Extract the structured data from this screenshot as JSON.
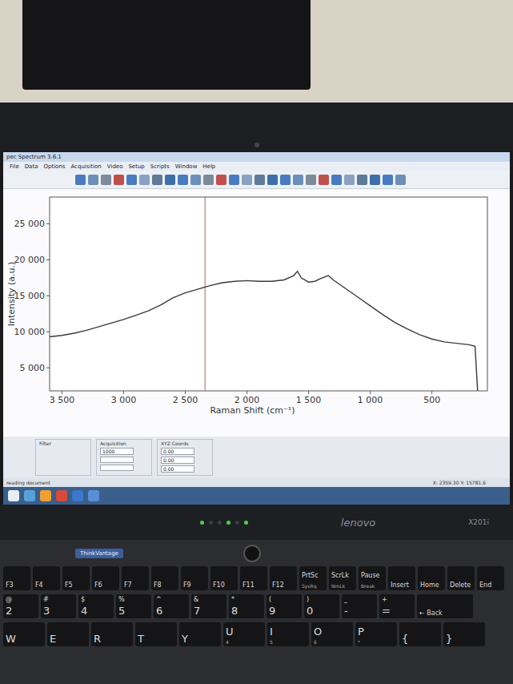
{
  "window": {
    "title": "pec Spectrum 3.6.1"
  },
  "menu": [
    "File",
    "Data",
    "Options",
    "Acquisition",
    "Video",
    "Setup",
    "Scripts",
    "Window",
    "Help"
  ],
  "chart": {
    "y_label": "Intensity (a.u.)",
    "x_label": "Raman Shift (cm⁻¹)",
    "x_min": 3600,
    "x_max": 50,
    "y_min": 1800,
    "y_max": 28700,
    "y_ticks": [
      {
        "label": "25 000",
        "value": 25000
      },
      {
        "label": "20 000",
        "value": 20000
      },
      {
        "label": "15 000",
        "value": 15000
      },
      {
        "label": "10 000",
        "value": 10000
      },
      {
        "label": "5 000",
        "value": 5000
      }
    ],
    "x_ticks": [
      {
        "label": "3 500",
        "value": 3500
      },
      {
        "label": "3 000",
        "value": 3000
      },
      {
        "label": "2 500",
        "value": 2500
      },
      {
        "label": "2 000",
        "value": 2000
      },
      {
        "label": "1 500",
        "value": 1500
      },
      {
        "label": "1 000",
        "value": 1000
      },
      {
        "label": "500",
        "value": 500
      }
    ],
    "cursor_x": 2340,
    "series": [
      {
        "name": "spectrum",
        "color": "#3a3a3a",
        "x": [
          3600,
          3500,
          3400,
          3300,
          3200,
          3100,
          3000,
          2900,
          2800,
          2700,
          2600,
          2500,
          2400,
          2300,
          2200,
          2100,
          2000,
          1900,
          1800,
          1700,
          1620,
          1590,
          1560,
          1500,
          1450,
          1400,
          1340,
          1300,
          1200,
          1100,
          1000,
          900,
          800,
          700,
          600,
          500,
          400,
          300,
          200,
          150,
          130
        ],
        "y": [
          9300,
          9500,
          9800,
          10200,
          10700,
          11200,
          11700,
          12300,
          12900,
          13700,
          14700,
          15400,
          15900,
          16400,
          16800,
          17000,
          17100,
          17000,
          17000,
          17200,
          17800,
          18400,
          17500,
          16900,
          17000,
          17400,
          17800,
          17200,
          16000,
          14800,
          13600,
          12400,
          11300,
          10400,
          9600,
          9000,
          8600,
          8400,
          8200,
          8000,
          2000
        ]
      }
    ]
  },
  "panels": [
    {
      "title": "Filter",
      "fields": []
    },
    {
      "title": "Acquisition",
      "fields": [
        "1000",
        "",
        ""
      ]
    },
    {
      "title": "XYZ Coords",
      "fields": [
        "0.00",
        "0.00",
        "0.00"
      ]
    }
  ],
  "status_bar": {
    "message": "reading document",
    "coords": "X: 2359.30  Y: 15781.6"
  },
  "laptop": {
    "brand": "lenovo",
    "model": "X201i",
    "thinkvantage": "ThinkVantage"
  },
  "keyboard": {
    "function_row": [
      {
        "main": "F3"
      },
      {
        "main": "F4"
      },
      {
        "main": "F5"
      },
      {
        "main": "F6"
      },
      {
        "main": "F7"
      },
      {
        "main": "F8"
      },
      {
        "main": "F9"
      },
      {
        "main": "F10"
      },
      {
        "main": "F11"
      },
      {
        "main": "F12"
      },
      {
        "main": "PrtSc",
        "sub": "SysRq"
      },
      {
        "main": "ScrLk",
        "sub": "NmLk"
      },
      {
        "main": "Pause",
        "sub": "Break"
      },
      {
        "main": "Insert"
      },
      {
        "main": "Home"
      },
      {
        "main": "Delete"
      },
      {
        "main": "End"
      }
    ],
    "number_row": [
      {
        "top": "@",
        "main": "2"
      },
      {
        "top": "#",
        "main": "3"
      },
      {
        "top": "$",
        "main": "4"
      },
      {
        "top": "%",
        "main": "5"
      },
      {
        "top": "^",
        "main": "6"
      },
      {
        "top": "&",
        "main": "7"
      },
      {
        "top": "*",
        "main": "8"
      },
      {
        "top": "(",
        "main": "9"
      },
      {
        "top": ")",
        "main": "0"
      },
      {
        "top": "_",
        "main": "-"
      },
      {
        "top": "+",
        "main": "="
      },
      {
        "top": "",
        "main": "← Back"
      }
    ],
    "letter_row": [
      {
        "main": "W"
      },
      {
        "main": "E"
      },
      {
        "main": "R"
      },
      {
        "main": "T"
      },
      {
        "main": "Y"
      },
      {
        "main": "U",
        "sub": "4"
      },
      {
        "main": "I",
        "sub": "5"
      },
      {
        "main": "O",
        "sub": "6"
      },
      {
        "main": "P",
        "sub": "*"
      },
      {
        "main": "{"
      },
      {
        "main": "}"
      }
    ]
  }
}
